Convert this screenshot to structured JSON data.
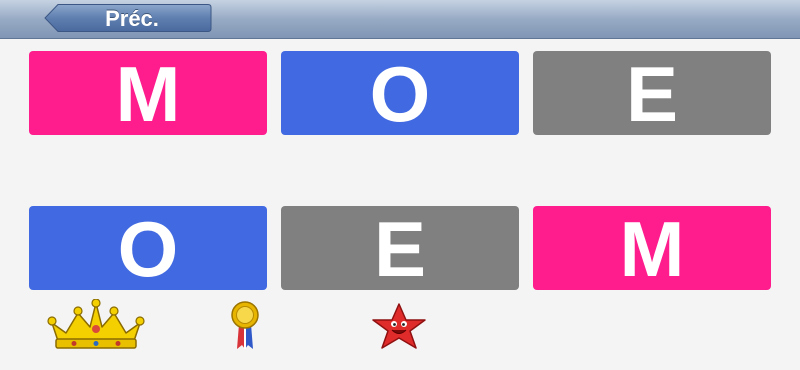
{
  "header": {
    "back_label": "Préc."
  },
  "colors": {
    "pink": "#ff1d8e",
    "blue": "#4169e1",
    "gray": "#808080"
  },
  "top_row": [
    {
      "letter": "M",
      "color": "pink"
    },
    {
      "letter": "O",
      "color": "blue"
    },
    {
      "letter": "E",
      "color": "gray"
    }
  ],
  "bottom_row": [
    {
      "letter": "O",
      "color": "blue"
    },
    {
      "letter": "E",
      "color": "gray"
    },
    {
      "letter": "M",
      "color": "pink"
    }
  ],
  "awards": [
    "crown-icon",
    "ribbon-medal-icon",
    "star-face-icon"
  ]
}
